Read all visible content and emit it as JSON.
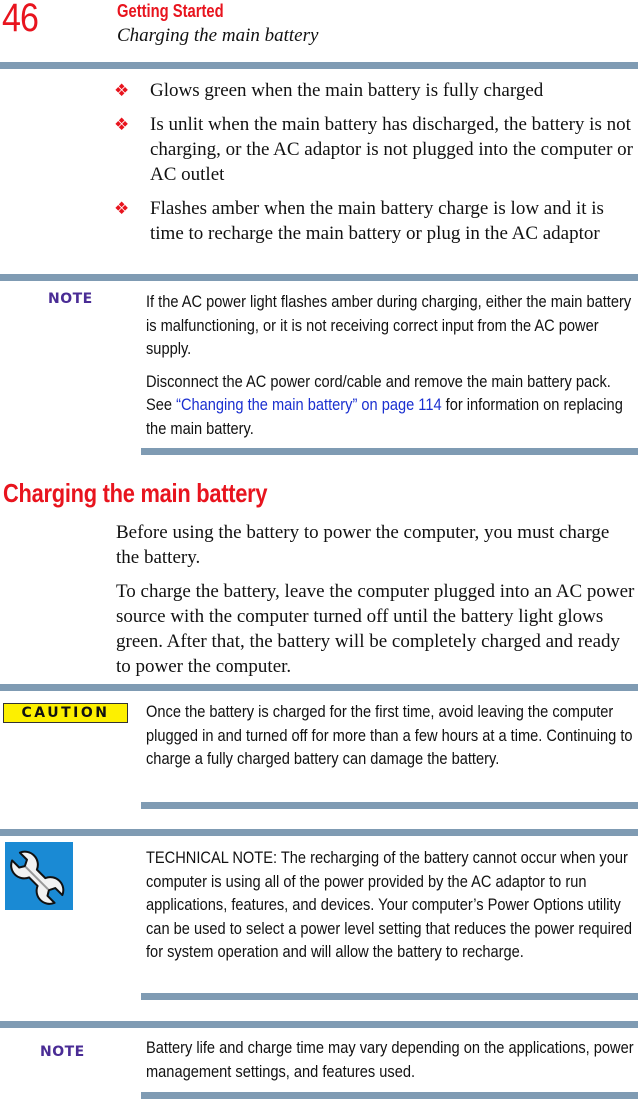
{
  "header": {
    "page_number": "46",
    "section": "Getting Started",
    "subtitle": "Charging the main battery"
  },
  "bullets": [
    {
      "icon": "diamond-bullet-icon",
      "text": "Glows green when the main battery is fully charged"
    },
    {
      "icon": "diamond-bullet-icon",
      "text": "Is unlit when the main battery has discharged, the battery is not charging, or the AC adaptor is not plugged into the computer or AC outlet"
    },
    {
      "icon": "diamond-bullet-icon",
      "text": "Flashes amber when the main battery charge is low and it is time to recharge the main battery or plug in the AC adaptor"
    }
  ],
  "note1": {
    "label": "NOTE",
    "para1": "If the AC power light flashes amber during charging, either the main battery is malfunctioning, or it is not receiving correct input from the AC power supply.",
    "para2_before": "Disconnect the AC power cord/cable and remove the main battery pack. See ",
    "para2_link": "“Changing the main battery” on page 114",
    "para2_after": " for information on replacing the main battery."
  },
  "section": {
    "heading": "Charging the main battery",
    "para1": "Before using the battery to power the computer, you must charge the battery.",
    "para2": "To charge the battery, leave the computer plugged into an AC power source with the computer turned off until the battery light glows green. After that, the battery will be completely charged and ready to power the computer."
  },
  "caution": {
    "label": "CAUTION",
    "text": "Once the battery is charged for the first time, avoid leaving the computer plugged in and turned off for more than a few hours at a time. Continuing to charge a fully charged battery can damage the battery."
  },
  "technical_note": {
    "icon": "wrench-icon",
    "text": "TECHNICAL NOTE: The recharging of the battery cannot occur when your computer is using all of the power provided by the AC adaptor to run applications, features, and devices. Your computer’s Power Options utility can be used to select a power level setting that reduces the power required for system operation and will allow the battery to recharge."
  },
  "note2": {
    "label": "NOTE",
    "text": "Battery life and charge time may vary depending on the applications, power management settings, and features used."
  },
  "colors": {
    "accent_red": "#e8141e",
    "rule": "#7f9bb3",
    "note_label": "#4a2c95",
    "link": "#1a2fd0",
    "caution_yellow": "#fdf000",
    "wrench_blue": "#1a8ad4"
  }
}
